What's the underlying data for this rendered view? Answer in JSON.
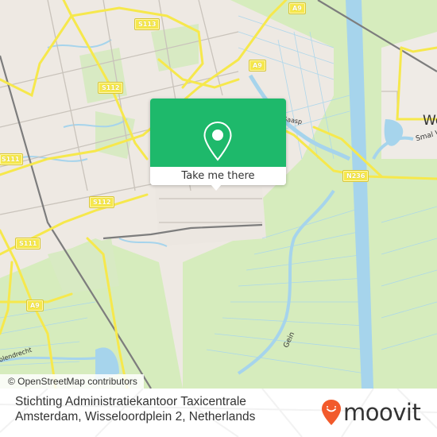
{
  "map": {
    "provider_attribution": "© OpenStreetMap contributors",
    "colors": {
      "land": "#eee9e3",
      "park": "#d6ecbd",
      "water": "#a6d4ec",
      "road_major": "#f6e84c",
      "road_minor": "#c9c3bb",
      "rail": "#7d7d7d"
    },
    "road_shields": [
      {
        "label": "S113",
        "ref": "s113"
      },
      {
        "label": "S112",
        "ref": "s112-top"
      },
      {
        "label": "S112",
        "ref": "s112-bottom"
      },
      {
        "label": "S111",
        "ref": "s111-top"
      },
      {
        "label": "S111",
        "ref": "s111-bottom"
      },
      {
        "label": "A9",
        "ref": "a9-top"
      },
      {
        "label": "A9",
        "ref": "a9-mid"
      },
      {
        "label": "A9",
        "ref": "a9-bottom"
      },
      {
        "label": "N236",
        "ref": "n236"
      }
    ],
    "place_labels": [
      {
        "text": "We",
        "ref": "weesp"
      },
      {
        "text": "Smal W",
        "ref": "smal-weesp"
      },
      {
        "text": "Gein",
        "ref": "gein"
      },
      {
        "text": "Holendrecht",
        "ref": "holendrecht"
      },
      {
        "text": "Gaasp",
        "ref": "gaasp"
      }
    ]
  },
  "popup": {
    "icon": "map-pin-icon",
    "button_label": "Take me there",
    "accent_color": "#1eb96b"
  },
  "footer": {
    "place_name_line1": "Stichting Administratiekantoor Taxicentrale",
    "place_name_line2": "Amsterdam, Wisseloordplein 2, Netherlands",
    "brand": "moovit",
    "brand_color": "#f25a2b"
  }
}
